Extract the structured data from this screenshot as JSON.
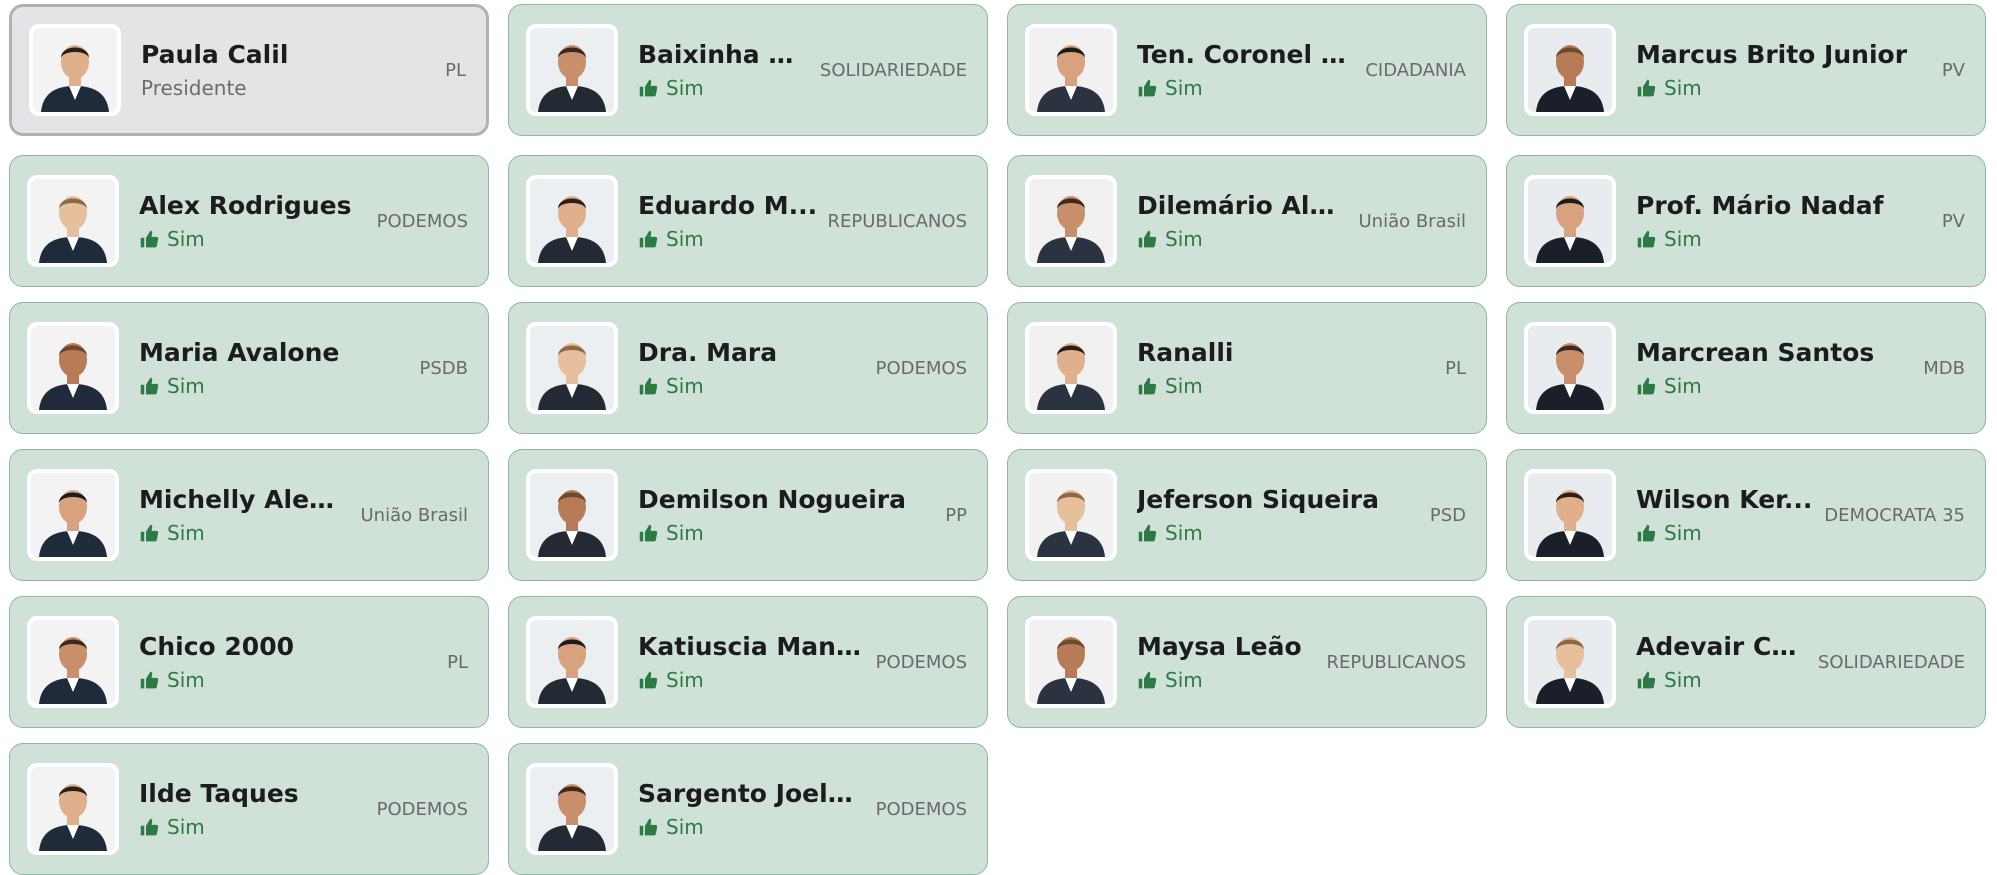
{
  "colors": {
    "card_bg": "#d0e1d7",
    "card_border": "#8fb8a0",
    "president_bg": "#e3e4e6",
    "vote_green": "#2c7a44"
  },
  "vote_icon": "thumbs-up-icon",
  "members": [
    {
      "name": "Paula Calil",
      "subtitle": "Presidente",
      "party": "PL",
      "is_president": true
    },
    {
      "name": "Baixinha Gi...",
      "vote": "Sim",
      "party": "SOLIDARIEDADE"
    },
    {
      "name": "Ten. Coronel D...",
      "vote": "Sim",
      "party": "CIDADANIA"
    },
    {
      "name": "Marcus Brito Junior",
      "vote": "Sim",
      "party": "PV"
    },
    {
      "name": "Alex Rodrigues",
      "vote": "Sim",
      "party": "PODEMOS"
    },
    {
      "name": "Eduardo M...",
      "vote": "Sim",
      "party": "REPUBLICANOS"
    },
    {
      "name": "Dilemário Ale...",
      "vote": "Sim",
      "party": "União Brasil"
    },
    {
      "name": "Prof. Mário Nadaf",
      "vote": "Sim",
      "party": "PV"
    },
    {
      "name": "Maria Avalone",
      "vote": "Sim",
      "party": "PSDB"
    },
    {
      "name": "Dra. Mara",
      "vote": "Sim",
      "party": "PODEMOS"
    },
    {
      "name": "Ranalli",
      "vote": "Sim",
      "party": "PL"
    },
    {
      "name": "Marcrean Santos",
      "vote": "Sim",
      "party": "MDB"
    },
    {
      "name": "Michelly Alencar",
      "vote": "Sim",
      "party": "União Brasil"
    },
    {
      "name": "Demilson Nogueira",
      "vote": "Sim",
      "party": "PP"
    },
    {
      "name": "Jeferson Siqueira",
      "vote": "Sim",
      "party": "PSD"
    },
    {
      "name": "Wilson Ker...",
      "vote": "Sim",
      "party": "DEMOCRATA 35"
    },
    {
      "name": "Chico 2000",
      "vote": "Sim",
      "party": "PL"
    },
    {
      "name": "Katiuscia Manteli",
      "vote": "Sim",
      "party": "PODEMOS"
    },
    {
      "name": "Maysa Leão",
      "vote": "Sim",
      "party": "REPUBLICANOS"
    },
    {
      "name": "Adevair Ca...",
      "vote": "Sim",
      "party": "SOLIDARIEDADE"
    },
    {
      "name": "Ilde Taques",
      "vote": "Sim",
      "party": "PODEMOS"
    },
    {
      "name": "Sargento Joelson",
      "vote": "Sim",
      "party": "PODEMOS"
    }
  ]
}
